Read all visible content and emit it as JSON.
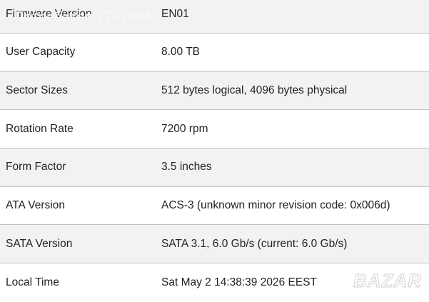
{
  "rows": [
    {
      "label": "Firmware Version",
      "value": "EN01"
    },
    {
      "label": "User Capacity",
      "value": "8.00 TB"
    },
    {
      "label": "Sector Sizes",
      "value": "512 bytes logical, 4096 bytes physical"
    },
    {
      "label": "Rotation Rate",
      "value": "7200 rpm"
    },
    {
      "label": "Form Factor",
      "value": "3.5 inches"
    },
    {
      "label": "ATA Version",
      "value": "ACS-3 (unknown minor revision code: 0x006d)"
    },
    {
      "label": "SATA Version",
      "value": "SATA 3.1, 6.0 Gb/s (current: 6.0 Gb/s)"
    },
    {
      "label": "Local Time",
      "value": "Sat May 2 14:38:39 2026 EEST"
    }
  ],
  "watermark": "Потребител 2792004",
  "logo": "BAZAR",
  "colors": {
    "row_odd": "#f2f2f2",
    "row_even": "#ffffff",
    "divider": "#c4c4c4",
    "text": "#222222"
  }
}
